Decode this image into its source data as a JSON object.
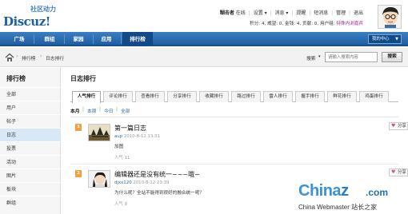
{
  "header": {
    "slogan": "社区动力",
    "brand": "Discuz!",
    "user": {
      "name": "糊击者",
      "online_status": "在线",
      "links": [
        "设置",
        "消息",
        "提醒",
        "短消息",
        "管理",
        "退出"
      ],
      "stats_text": "积分: 4, 威望: 0, 金钱: 4, 贡献: 0, 用户组:",
      "usergroup": "特殊内测嘉宾"
    }
  },
  "nav": {
    "items": [
      "广场",
      "群组",
      "家园",
      "应用",
      "排行榜"
    ],
    "active": "排行榜",
    "quick_center": "我的中心"
  },
  "breadcrumb": {
    "items": [
      "排行榜",
      "日志排行"
    ]
  },
  "search": {
    "label": "搜索",
    "placeholder": "请输入搜索内容",
    "button": "搜索"
  },
  "sidebar": {
    "title": "排行榜",
    "items": [
      "全部",
      "用户",
      "帖子",
      "日志",
      "投票",
      "活动",
      "图片",
      "板块",
      "群组"
    ],
    "active": "日志"
  },
  "main": {
    "title": "日志排行",
    "tabs": [
      "人气排行",
      "评论排行",
      "查看排行",
      "分享排行",
      "收藏排行",
      "路过排行",
      "雷人排行",
      "握手排行",
      "鲜花排行",
      "鸡蛋排行"
    ],
    "active_tab": "人气排行",
    "filters": [
      "本月",
      "本周",
      "今日",
      "全部"
    ],
    "active_filter": "本月",
    "entries": [
      {
        "rank": "1",
        "title": "第一篇日志",
        "author": "aup",
        "date": "2010-8-12 13:31",
        "body": "加图",
        "popularity": "人气 11",
        "share": "分享"
      },
      {
        "rank": "2",
        "title": "编辑器还是没有统一~~~哦~",
        "author": "djxx120",
        "date": "2010-8-12 23:39",
        "body": "为什么呢？全站不能得到很好的融合统一呢？",
        "popularity": "人气 9",
        "share": "分享"
      }
    ]
  },
  "watermark": {
    "main": "China",
    "accent": "z",
    "dotcom": ".com",
    "sub": "China Webmaster 站长之家"
  }
}
